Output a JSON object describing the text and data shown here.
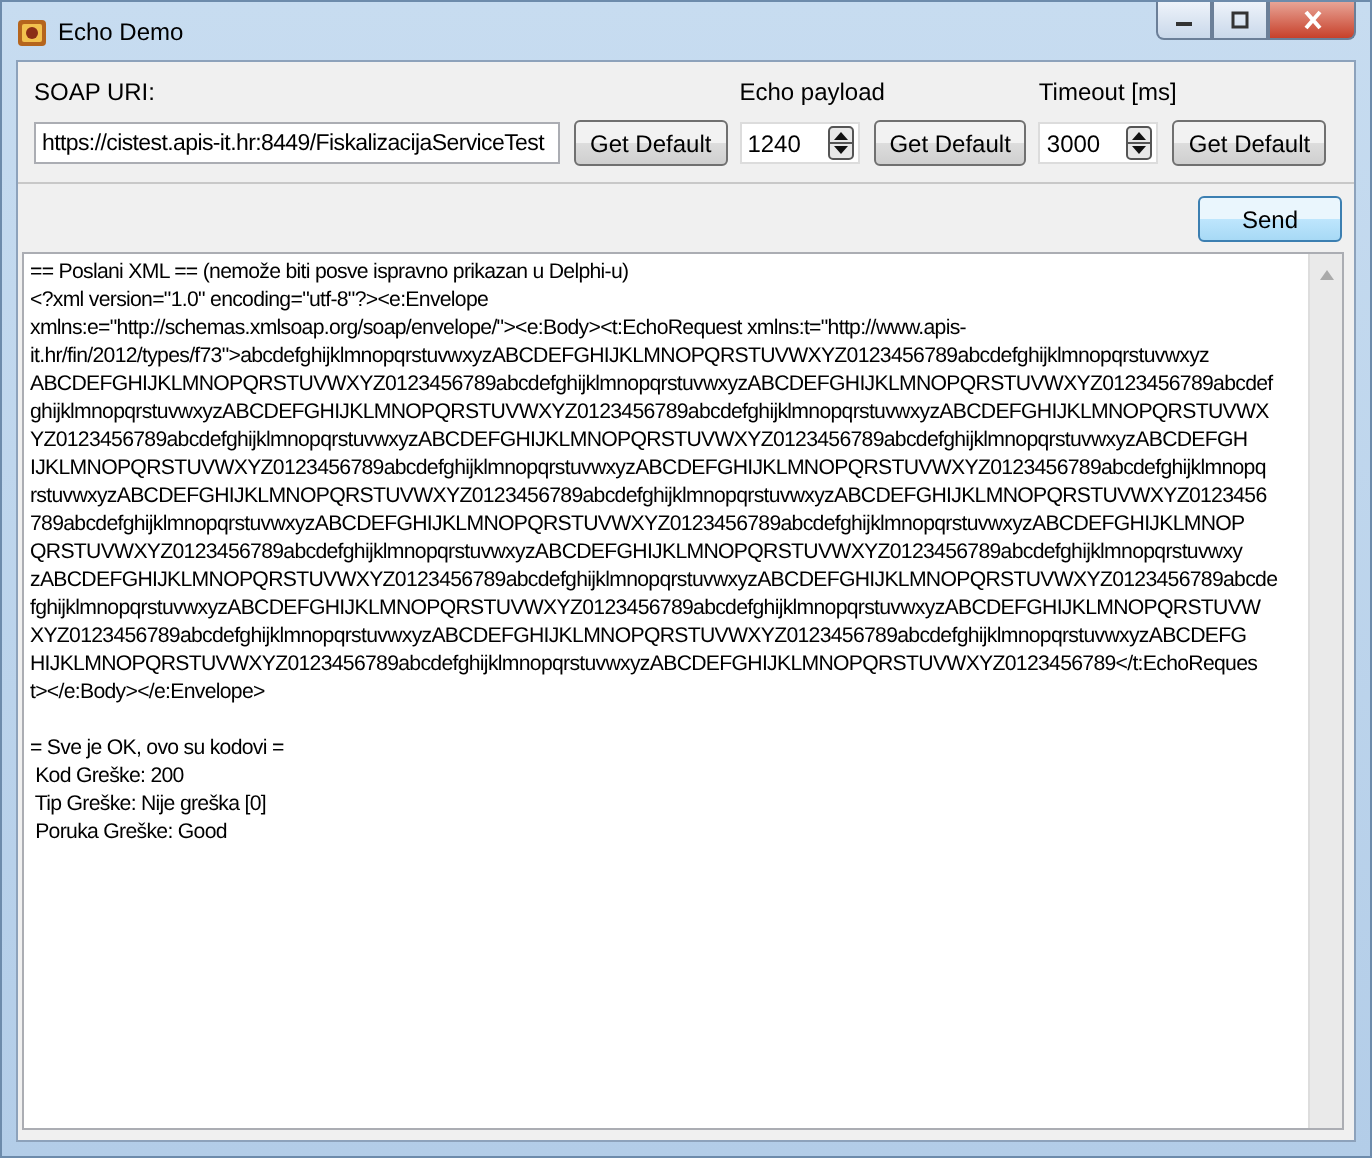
{
  "window": {
    "title": "Echo Demo"
  },
  "fields": [
    {
      "kind": "text",
      "label": "SOAP URI:",
      "value": "https://cistest.apis-it.hr:8449/FiskalizacijaServiceTest",
      "button": "Get Default"
    },
    {
      "kind": "spin",
      "label": "Echo payload",
      "value": "1240",
      "button": "Get Default"
    },
    {
      "kind": "spin",
      "label": "Timeout [ms]",
      "value": "3000",
      "button": "Get Default"
    }
  ],
  "send_button": "Send",
  "output": {
    "blocks": [
      {
        "lines": [
          "== Poslani XML == (nemože biti posve ispravno prikazan u Delphi-u)",
          "<?xml version=\"1.0\" encoding=\"utf-8\"?><e:Envelope",
          "xmlns:e=\"http://schemas.xmlsoap.org/soap/envelope/\"><e:Body><t:EchoRequest xmlns:t=\"http://www.apis-",
          "it.hr/fin/2012/types/f73\">abcdefghijklmnopqrstuvwxyzABCDEFGHIJKLMNOPQRSTUVWXYZ0123456789abcdefghijklmnopqrstuvwxyz",
          "ABCDEFGHIJKLMNOPQRSTUVWXYZ0123456789abcdefghijklmnopqrstuvwxyzABCDEFGHIJKLMNOPQRSTUVWXYZ0123456789abcdef",
          "ghijklmnopqrstuvwxyzABCDEFGHIJKLMNOPQRSTUVWXYZ0123456789abcdefghijklmnopqrstuvwxyzABCDEFGHIJKLMNOPQRSTUVWX",
          "YZ0123456789abcdefghijklmnopqrstuvwxyzABCDEFGHIJKLMNOPQRSTUVWXYZ0123456789abcdefghijklmnopqrstuvwxyzABCDEFGH",
          "IJKLMNOPQRSTUVWXYZ0123456789abcdefghijklmnopqrstuvwxyzABCDEFGHIJKLMNOPQRSTUVWXYZ0123456789abcdefghijklmnopq",
          "rstuvwxyzABCDEFGHIJKLMNOPQRSTUVWXYZ0123456789abcdefghijklmnopqrstuvwxyzABCDEFGHIJKLMNOPQRSTUVWXYZ0123456",
          "789abcdefghijklmnopqrstuvwxyzABCDEFGHIJKLMNOPQRSTUVWXYZ0123456789abcdefghijklmnopqrstuvwxyzABCDEFGHIJKLMNOP",
          "QRSTUVWXYZ0123456789abcdefghijklmnopqrstuvwxyzABCDEFGHIJKLMNOPQRSTUVWXYZ0123456789abcdefghijklmnopqrstuvwxy",
          "zABCDEFGHIJKLMNOPQRSTUVWXYZ0123456789abcdefghijklmnopqrstuvwxyzABCDEFGHIJKLMNOPQRSTUVWXYZ0123456789abcde",
          "fghijklmnopqrstuvwxyzABCDEFGHIJKLMNOPQRSTUVWXYZ0123456789abcdefghijklmnopqrstuvwxyzABCDEFGHIJKLMNOPQRSTUVW",
          "XYZ0123456789abcdefghijklmnopqrstuvwxyzABCDEFGHIJKLMNOPQRSTUVWXYZ0123456789abcdefghijklmnopqrstuvwxyzABCDEFG",
          "HIJKLMNOPQRSTUVWXYZ0123456789abcdefghijklmnopqrstuvwxyzABCDEFGHIJKLMNOPQRSTUVWXYZ0123456789</t:EchoReques",
          "t></e:Body></e:Envelope>"
        ]
      },
      {
        "lines": [
          "= Sve je OK, ovo su kodovi =",
          " Kod Greške: 200",
          " Tip Greške: Nije greška [0]",
          " Poruka Greške: Good"
        ]
      }
    ]
  }
}
